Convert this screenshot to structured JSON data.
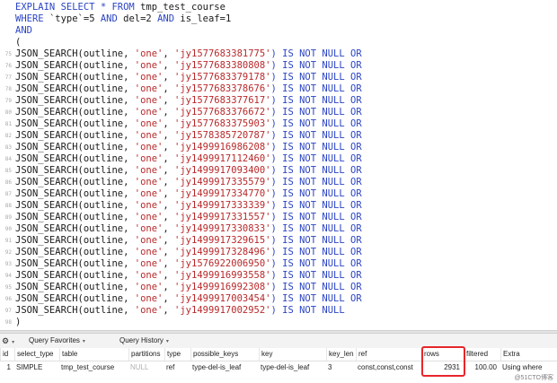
{
  "editor": {
    "lines": [
      {
        "n": "",
        "segments": [
          {
            "t": "EXPLAIN SELECT * ",
            "c": "kw"
          },
          {
            "t": "FROM ",
            "c": "kw"
          },
          {
            "t": "tmp_test_course",
            "c": "id"
          }
        ]
      },
      {
        "n": "",
        "segments": [
          {
            "t": "WHERE ",
            "c": "kw"
          },
          {
            "t": "`type`=5 ",
            "c": "id"
          },
          {
            "t": "AND ",
            "c": "kw"
          },
          {
            "t": "del=2 ",
            "c": "id"
          },
          {
            "t": "AND ",
            "c": "kw"
          },
          {
            "t": "is_leaf=1",
            "c": "id"
          }
        ]
      },
      {
        "n": "",
        "segments": [
          {
            "t": "AND",
            "c": "kw"
          }
        ]
      },
      {
        "n": "",
        "segments": [
          {
            "t": "(",
            "c": "id"
          }
        ]
      },
      {
        "n": "75",
        "segments": [
          {
            "t": "JSON_SEARCH(outline, ",
            "c": "id"
          },
          {
            "t": "'one'",
            "c": "str"
          },
          {
            "t": ", ",
            "c": "id"
          },
          {
            "t": "'jy1577683381775'",
            "c": "str"
          },
          {
            "t": ") IS NOT NULL OR",
            "c": "kw"
          }
        ]
      },
      {
        "n": "76",
        "segments": [
          {
            "t": "JSON_SEARCH(outline, ",
            "c": "id"
          },
          {
            "t": "'one'",
            "c": "str"
          },
          {
            "t": ", ",
            "c": "id"
          },
          {
            "t": "'jy1577683380808'",
            "c": "str"
          },
          {
            "t": ") IS NOT NULL OR",
            "c": "kw"
          }
        ]
      },
      {
        "n": "77",
        "segments": [
          {
            "t": "JSON_SEARCH(outline, ",
            "c": "id"
          },
          {
            "t": "'one'",
            "c": "str"
          },
          {
            "t": ", ",
            "c": "id"
          },
          {
            "t": "'jy1577683379178'",
            "c": "str"
          },
          {
            "t": ") IS NOT NULL OR",
            "c": "kw"
          }
        ]
      },
      {
        "n": "78",
        "segments": [
          {
            "t": "JSON_SEARCH(outline, ",
            "c": "id"
          },
          {
            "t": "'one'",
            "c": "str"
          },
          {
            "t": ", ",
            "c": "id"
          },
          {
            "t": "'jy1577683378676'",
            "c": "str"
          },
          {
            "t": ") IS NOT NULL OR",
            "c": "kw"
          }
        ]
      },
      {
        "n": "79",
        "segments": [
          {
            "t": "JSON_SEARCH(outline, ",
            "c": "id"
          },
          {
            "t": "'one'",
            "c": "str"
          },
          {
            "t": ", ",
            "c": "id"
          },
          {
            "t": "'jy1577683377617'",
            "c": "str"
          },
          {
            "t": ") IS NOT NULL OR",
            "c": "kw"
          }
        ]
      },
      {
        "n": "80",
        "segments": [
          {
            "t": "JSON_SEARCH(outline, ",
            "c": "id"
          },
          {
            "t": "'one'",
            "c": "str"
          },
          {
            "t": ", ",
            "c": "id"
          },
          {
            "t": "'jy1577683376672'",
            "c": "str"
          },
          {
            "t": ") IS NOT NULL OR",
            "c": "kw"
          }
        ]
      },
      {
        "n": "81",
        "segments": [
          {
            "t": "JSON_SEARCH(outline, ",
            "c": "id"
          },
          {
            "t": "'one'",
            "c": "str"
          },
          {
            "t": ", ",
            "c": "id"
          },
          {
            "t": "'jy1577683375903'",
            "c": "str"
          },
          {
            "t": ") IS NOT NULL OR",
            "c": "kw"
          }
        ]
      },
      {
        "n": "82",
        "segments": [
          {
            "t": "JSON_SEARCH(outline, ",
            "c": "id"
          },
          {
            "t": "'one'",
            "c": "str"
          },
          {
            "t": ", ",
            "c": "id"
          },
          {
            "t": "'jy1578385720787'",
            "c": "str"
          },
          {
            "t": ") IS NOT NULL OR",
            "c": "kw"
          }
        ]
      },
      {
        "n": "83",
        "segments": [
          {
            "t": "JSON_SEARCH(outline, ",
            "c": "id"
          },
          {
            "t": "'one'",
            "c": "str"
          },
          {
            "t": ", ",
            "c": "id"
          },
          {
            "t": "'jy1499916986208'",
            "c": "str"
          },
          {
            "t": ") IS NOT NULL OR",
            "c": "kw"
          }
        ]
      },
      {
        "n": "84",
        "segments": [
          {
            "t": "JSON_SEARCH(outline, ",
            "c": "id"
          },
          {
            "t": "'one'",
            "c": "str"
          },
          {
            "t": ", ",
            "c": "id"
          },
          {
            "t": "'jy1499917112460'",
            "c": "str"
          },
          {
            "t": ") IS NOT NULL OR",
            "c": "kw"
          }
        ]
      },
      {
        "n": "85",
        "segments": [
          {
            "t": "JSON_SEARCH(outline, ",
            "c": "id"
          },
          {
            "t": "'one'",
            "c": "str"
          },
          {
            "t": ", ",
            "c": "id"
          },
          {
            "t": "'jy1499917093400'",
            "c": "str"
          },
          {
            "t": ") IS NOT NULL OR",
            "c": "kw"
          }
        ]
      },
      {
        "n": "86",
        "segments": [
          {
            "t": "JSON_SEARCH(outline, ",
            "c": "id"
          },
          {
            "t": "'one'",
            "c": "str"
          },
          {
            "t": ", ",
            "c": "id"
          },
          {
            "t": "'jy1499917335579'",
            "c": "str"
          },
          {
            "t": ") IS NOT NULL OR",
            "c": "kw"
          }
        ]
      },
      {
        "n": "87",
        "segments": [
          {
            "t": "JSON_SEARCH(outline, ",
            "c": "id"
          },
          {
            "t": "'one'",
            "c": "str"
          },
          {
            "t": ", ",
            "c": "id"
          },
          {
            "t": "'jy1499917334770'",
            "c": "str"
          },
          {
            "t": ") IS NOT NULL OR",
            "c": "kw"
          }
        ]
      },
      {
        "n": "88",
        "segments": [
          {
            "t": "JSON_SEARCH(outline, ",
            "c": "id"
          },
          {
            "t": "'one'",
            "c": "str"
          },
          {
            "t": ", ",
            "c": "id"
          },
          {
            "t": "'jy1499917333339'",
            "c": "str"
          },
          {
            "t": ") IS NOT NULL OR",
            "c": "kw"
          }
        ]
      },
      {
        "n": "89",
        "segments": [
          {
            "t": "JSON_SEARCH(outline, ",
            "c": "id"
          },
          {
            "t": "'one'",
            "c": "str"
          },
          {
            "t": ", ",
            "c": "id"
          },
          {
            "t": "'jy1499917331557'",
            "c": "str"
          },
          {
            "t": ") IS NOT NULL OR",
            "c": "kw"
          }
        ]
      },
      {
        "n": "90",
        "segments": [
          {
            "t": "JSON_SEARCH(outline, ",
            "c": "id"
          },
          {
            "t": "'one'",
            "c": "str"
          },
          {
            "t": ", ",
            "c": "id"
          },
          {
            "t": "'jy1499917330833'",
            "c": "str"
          },
          {
            "t": ") IS NOT NULL OR",
            "c": "kw"
          }
        ]
      },
      {
        "n": "91",
        "segments": [
          {
            "t": "JSON_SEARCH(outline, ",
            "c": "id"
          },
          {
            "t": "'one'",
            "c": "str"
          },
          {
            "t": ", ",
            "c": "id"
          },
          {
            "t": "'jy1499917329615'",
            "c": "str"
          },
          {
            "t": ") IS NOT NULL OR",
            "c": "kw"
          }
        ]
      },
      {
        "n": "92",
        "segments": [
          {
            "t": "JSON_SEARCH(outline, ",
            "c": "id"
          },
          {
            "t": "'one'",
            "c": "str"
          },
          {
            "t": ", ",
            "c": "id"
          },
          {
            "t": "'jy1499917328496'",
            "c": "str"
          },
          {
            "t": ") IS NOT NULL OR",
            "c": "kw"
          }
        ]
      },
      {
        "n": "93",
        "segments": [
          {
            "t": "JSON_SEARCH(outline, ",
            "c": "id"
          },
          {
            "t": "'one'",
            "c": "str"
          },
          {
            "t": ", ",
            "c": "id"
          },
          {
            "t": "'jy1576922006950'",
            "c": "str"
          },
          {
            "t": ") IS NOT NULL OR",
            "c": "kw"
          }
        ]
      },
      {
        "n": "94",
        "segments": [
          {
            "t": "JSON_SEARCH(outline, ",
            "c": "id"
          },
          {
            "t": "'one'",
            "c": "str"
          },
          {
            "t": ", ",
            "c": "id"
          },
          {
            "t": "'jy1499916993558'",
            "c": "str"
          },
          {
            "t": ") IS NOT NULL OR",
            "c": "kw"
          }
        ]
      },
      {
        "n": "95",
        "segments": [
          {
            "t": "JSON_SEARCH(outline, ",
            "c": "id"
          },
          {
            "t": "'one'",
            "c": "str"
          },
          {
            "t": ", ",
            "c": "id"
          },
          {
            "t": "'jy1499916992308'",
            "c": "str"
          },
          {
            "t": ") IS NOT NULL OR",
            "c": "kw"
          }
        ]
      },
      {
        "n": "96",
        "segments": [
          {
            "t": "JSON_SEARCH(outline, ",
            "c": "id"
          },
          {
            "t": "'one'",
            "c": "str"
          },
          {
            "t": ", ",
            "c": "id"
          },
          {
            "t": "'jy1499917003454'",
            "c": "str"
          },
          {
            "t": ") IS NOT NULL OR",
            "c": "kw"
          }
        ]
      },
      {
        "n": "97",
        "segments": [
          {
            "t": "JSON_SEARCH(outline, ",
            "c": "id"
          },
          {
            "t": "'one'",
            "c": "str"
          },
          {
            "t": ", ",
            "c": "id"
          },
          {
            "t": "'jy1499917002952'",
            "c": "str"
          },
          {
            "t": ") IS NOT NULL",
            "c": "kw"
          }
        ]
      },
      {
        "n": "98",
        "segments": [
          {
            "t": ")",
            "c": "id"
          }
        ]
      }
    ]
  },
  "toolbar": {
    "gear_glyph": "⚙",
    "caret_glyph": "▾",
    "query_favorites": "Query Favorites",
    "query_history": "Query History"
  },
  "results": {
    "columns": [
      "id",
      "select_type",
      "table",
      "partitions",
      "type",
      "possible_keys",
      "key",
      "key_len",
      "ref",
      "rows",
      "filtered",
      "Extra"
    ],
    "row": [
      "1",
      "SIMPLE",
      "tmp_test_course",
      "NULL",
      "ref",
      "type-del-is_leaf",
      "type-del-is_leaf",
      "3",
      "const,const,const",
      "2931",
      "100.00",
      "Using where"
    ]
  },
  "watermark": "@51CTO博客",
  "colors": {
    "keyword": "#2b44c4",
    "string": "#b8282a",
    "highlight": "#e8262b"
  }
}
